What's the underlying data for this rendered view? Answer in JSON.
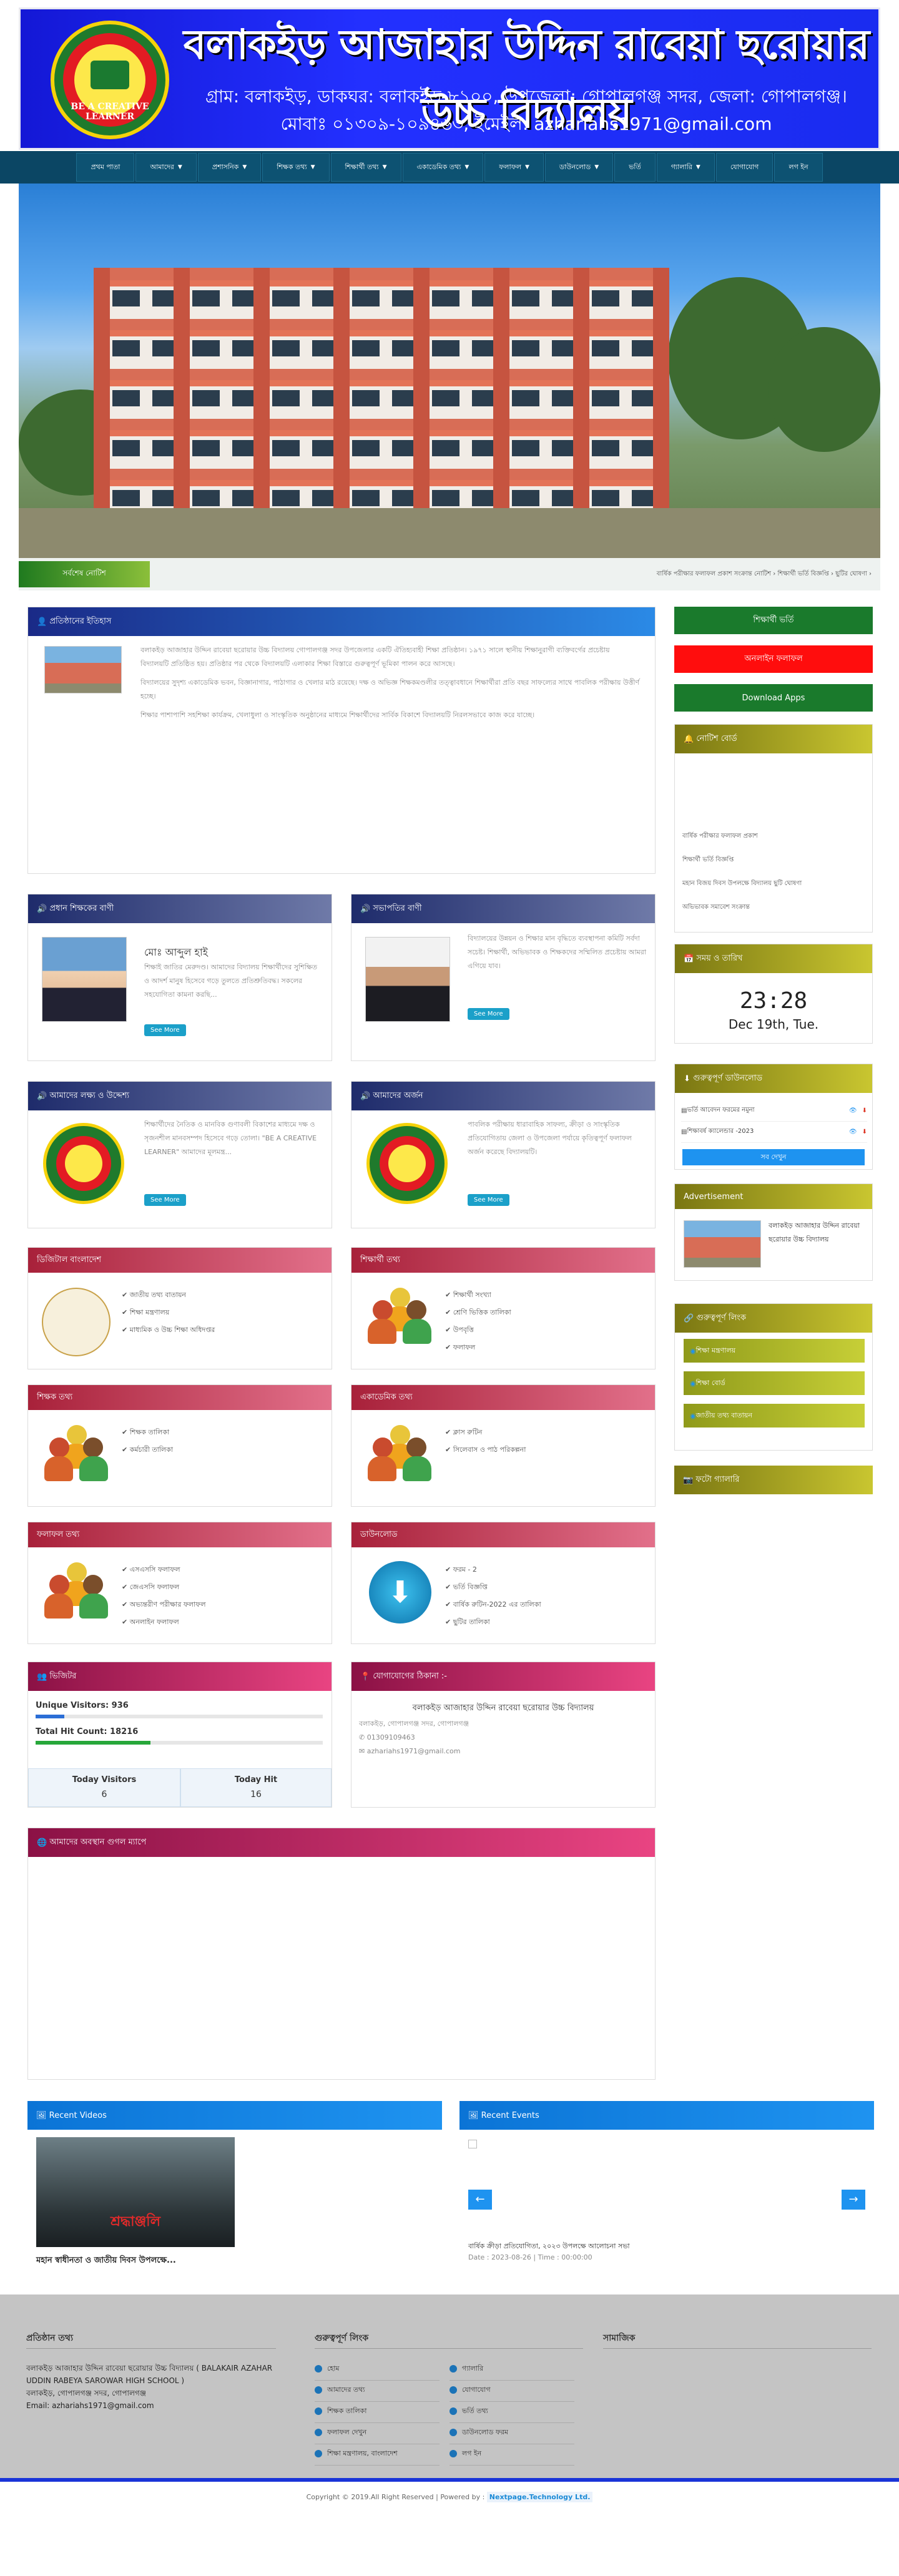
{
  "header": {
    "school_name": "বলাকইড় আজাহার উদ্দিন রাবেয়া ছরোয়ার উচ্চ বিদ্যালয়",
    "address": "গ্রাম: বলাকইড়, ডাকঘর: বলাকইড়-৮১০০, উপজেলা: গোপালগঞ্জ সদর, জেলা: গোপালগঞ্জ।",
    "contact": "মোবাঃ ০১৩০৯-১০৯৪৬৩, ইমেইল: azhariahs1971@gmail.com",
    "logo_label": "BE A CREATIVE LEARNER",
    "brand_color": "#1d26e8"
  },
  "nav": {
    "items": [
      {
        "label": "প্রথম পাতা",
        "dropdown": false
      },
      {
        "label": "আমাদের",
        "dropdown": true
      },
      {
        "label": "প্রশাসনিক",
        "dropdown": true
      },
      {
        "label": "শিক্ষক তথ্য",
        "dropdown": true
      },
      {
        "label": "শিক্ষার্থী তথ্য",
        "dropdown": true
      },
      {
        "label": "একাডেমিক তথ্য",
        "dropdown": true
      },
      {
        "label": "ফলাফল",
        "dropdown": true
      },
      {
        "label": "ডাউনলোড",
        "dropdown": true
      },
      {
        "label": "ভর্তি",
        "dropdown": false
      },
      {
        "label": "গ্যালারি",
        "dropdown": true
      },
      {
        "label": "যোগাযোগ",
        "dropdown": false
      },
      {
        "label": "লগ ইন",
        "dropdown": false
      }
    ]
  },
  "marquee": {
    "label": "সর্বশেষ নোটিশ",
    "text": "বার্ষিক পরীক্ষার ফলাফল প্রকাশ সংক্রান্ত নোটিশ ›  শিক্ষার্থী ভর্তি বিজ্ঞপ্তি ›  ছুটির ঘোষণা ›"
  },
  "history": {
    "title": "প্রতিষ্ঠানের ইতিহাস",
    "paragraphs": [
      "বলাকইড় আজাহার উদ্দিন রাবেয়া ছরোয়ার উচ্চ বিদ্যালয় গোপালগঞ্জ সদর উপজেলার একটি ঐতিহ্যবাহী শিক্ষা প্রতিষ্ঠান। ১৯৭১ সালে স্থানীয় শিক্ষানুরাগী ব্যক্তিবর্গের প্রচেষ্টায় বিদ্যালয়টি প্রতিষ্ঠিত হয়। প্রতিষ্ঠার পর থেকে বিদ্যালয়টি এলাকার শিক্ষা বিস্তারে গুরুত্বপূর্ণ ভূমিকা পালন করে আসছে।",
      "বিদ্যালয়ের সুদৃশ্য একাডেমিক ভবন, বিজ্ঞানাগার, পাঠাগার ও খেলার মাঠ রয়েছে। দক্ষ ও অভিজ্ঞ শিক্ষকমণ্ডলীর তত্ত্বাবধানে শিক্ষার্থীরা প্রতি বছর সাফল্যের সাথে পাবলিক পরীক্ষায় উত্তীর্ণ হচ্ছে।",
      "শিক্ষার পাশাপাশি সহশিক্ষা কার্যক্রম, খেলাধুলা ও সাংস্কৃতিক অনুষ্ঠানের মাধ্যমে শিক্ষার্থীদের সার্বিক বিকাশে বিদ্যালয়টি নিরলসভাবে কাজ করে যাচ্ছে।"
    ]
  },
  "messages": [
    {
      "title": "প্রধান শিক্ষকের বাণী",
      "name": "মোঃ আব্দুল হাই",
      "text": "শিক্ষাই জাতির মেরুদণ্ড। আমাদের বিদ্যালয় শিক্ষার্থীদের সুশিক্ষিত ও আদর্শ মানুষ হিসেবে গড়ে তুলতে প্রতিশ্রুতিবদ্ধ। সকলের সহযোগিতা কামনা করছি...",
      "button": "See More"
    },
    {
      "title": "সভাপতির বাণী",
      "name": "",
      "text": "বিদ্যালয়ের উন্নয়ন ও শিক্ষার মান বৃদ্ধিতে ব্যবস্থাপনা কমিটি সর্বদা সচেষ্ট। শিক্ষার্থী, অভিভাবক ও শিক্ষকদের সম্মিলিত প্রচেষ্টায় আমরা এগিয়ে যাব।",
      "button": "See More"
    },
    {
      "title": "আমাদের লক্ষ্য ও উদ্দেশ্য",
      "name": "",
      "text": "শিক্ষার্থীদের নৈতিক ও মানবিক গুণাবলী বিকাশের মাধ্যমে দক্ষ ও সৃজনশীল মানবসম্পদ হিসেবে গড়ে তোলা। \"BE A CREATIVE LEARNER\" আমাদের মূলমন্ত্র...",
      "button": "See More"
    },
    {
      "title": "আমাদের অর্জন",
      "name": "",
      "text": "পাবলিক পরীক্ষায় ধারাবাহিক সাফল্য, ক্রীড়া ও সাংস্কৃতিক প্রতিযোগিতায় জেলা ও উপজেলা পর্যায়ে কৃতিত্বপূর্ণ ফলাফল অর্জন করেছে বিদ্যালয়টি।",
      "button": "See More"
    }
  ],
  "info_boxes": [
    {
      "title": "ডিজিটাল বাংলাদেশ",
      "items": [
        "জাতীয় তথ্য বাতায়ন",
        "শিক্ষা মন্ত্রণালয়",
        "মাধ্যমিক ও উচ্চ শিক্ষা অধিদপ্তর"
      ]
    },
    {
      "title": "শিক্ষার্থী তথ্য",
      "items": [
        "শিক্ষার্থী সংখ্যা",
        "শ্রেণি ভিত্তিক তালিকা",
        "উপবৃত্তি",
        "ফলাফল"
      ]
    },
    {
      "title": "শিক্ষক তথ্য",
      "items": [
        "শিক্ষক তালিকা",
        "কর্মচারী তালিকা"
      ]
    },
    {
      "title": "একাডেমিক তথ্য",
      "items": [
        "ক্লাস রুটিন",
        "সিলেবাস ও পাঠ পরিকল্পনা"
      ]
    },
    {
      "title": "ফলাফল তথ্য",
      "items": [
        "এসএসসি ফলাফল",
        "জেএসসি ফলাফল",
        "অভ্যন্তরীণ পরীক্ষার ফলাফল",
        "অনলাইন ফলাফল"
      ]
    },
    {
      "title": "ডাউনলোড",
      "items": [
        "ফরম - 2",
        "ভর্তি বিজ্ঞপ্তি",
        "বার্ষিক রুটিন-2022 এর তালিকা",
        "ছুটির তালিকা"
      ]
    }
  ],
  "visitors": {
    "title": "ভিজিটর",
    "unique_label": "Unique Visitors: 936",
    "total_label": "Total Hit Count: 18216",
    "today_visitors_label": "Today Visitors",
    "today_visitors": "6",
    "today_hit_label": "Today Hit",
    "today_hit": "16"
  },
  "contact": {
    "title": "যোগাযোগের ঠিকানা :-",
    "name": "বলাকইড় আজাহার উদ্দিন রাবেয়া ছরোয়ার উচ্চ বিদ্যালয়",
    "address": "বলাকইড়, গোপালগঞ্জ সদর, গোপালগঞ্জ",
    "phone": "01309109463",
    "email": "azhariahs1971@gmail.com"
  },
  "map": {
    "title": "আমাদের অবস্থান গুগল ম্যাপে"
  },
  "recent_videos": {
    "title": "Recent Videos",
    "caption": "মহান স্বাধীনতা ও জাতীয় দিবস উপলক্ষে...",
    "thumb_text": "শ্রদ্ধাঞ্জলি"
  },
  "recent_events": {
    "title": "Recent Events",
    "event_title": "বার্ষিক ক্রীড়া প্রতিযোগিতা, ২০২৩ উপলক্ষে আলোচনা সভা",
    "event_date": "Date : 2023-08-26 | Time : 00:00:00"
  },
  "sidebar": {
    "buttons": [
      {
        "label": "শিক্ষার্থী ভর্তি",
        "color": "#1a7a2c"
      },
      {
        "label": "অনলাইন ফলাফল",
        "color": "#ff0d0d"
      },
      {
        "label": "Download Apps",
        "color": "#1a7a2c"
      }
    ],
    "notice_title": "নোটিশ বোর্ড",
    "notices": [
      "বার্ষিক পরীক্ষার ফলাফল প্রকাশ",
      "শিক্ষার্থী ভর্তি বিজ্ঞপ্তি",
      "মহান বিজয় দিবস উপলক্ষে বিদ্যালয় ছুটি ঘোষণা",
      "অভিভাবক সমাবেশ সংক্রান্ত"
    ],
    "time_title": "সময় ও তারিখ",
    "clock_time": "23:28",
    "clock_date": "Dec 19th, Tue.",
    "downloads_title": "গুরুত্বপূর্ণ ডাউনলোড",
    "downloads": [
      "ভর্তি আবেদন ফরমের নমুনা",
      "শিক্ষাবর্ষ ক্যালেন্ডার -2023"
    ],
    "all_button": "সব দেখুন",
    "ad_title": "Advertisement",
    "ad_text": "বলাকইড় আজাহার উদ্দিন রাবেয়া ছরোয়ার উচ্চ বিদ্যালয়",
    "links_title": "গুরুত্বপূর্ণ লিংক",
    "links": [
      "শিক্ষা মন্ত্রণালয়",
      "শিক্ষা বোর্ড",
      "জাতীয় তথ্য বাতায়ন"
    ],
    "gallery_title": "ফটো গ্যালারি"
  },
  "footer": {
    "about_title": "প্রতিষ্ঠান তথ্য",
    "about_text": "বলাকইড় আজাহার উদ্দিন রাবেয়া ছরোয়ার উচ্চ বিদ্যালয় ( BALAKAIR AZAHAR UDDIN RABEYA SAROWAR HIGH SCHOOL )",
    "about_addr": "বলাকইড়, গোপালগঞ্জ সদর, গোপালগঞ্জ",
    "about_email": "Email: azhariahs1971@gmail.com",
    "links_title": "গুরুত্বপূর্ণ লিংক",
    "links_col1": [
      "হোম",
      "আমাদের তথ্য",
      "শিক্ষক তালিকা",
      "ফলাফল দেখুন",
      "শিক্ষা মন্ত্রণালয়, বাংলাদেশ"
    ],
    "links_col2": [
      "গ্যালারি",
      "যোগাযোগ",
      "ভর্তি তথ্য",
      "ডাউনলোড ফরম",
      "লগ ইন"
    ],
    "social_title": "সামাজিক",
    "copyright": "Copyright © 2019.All Right Reserved | Powered by :",
    "powered": "Nextpage.Technology Ltd.",
    "accent": "#1a34d8"
  }
}
